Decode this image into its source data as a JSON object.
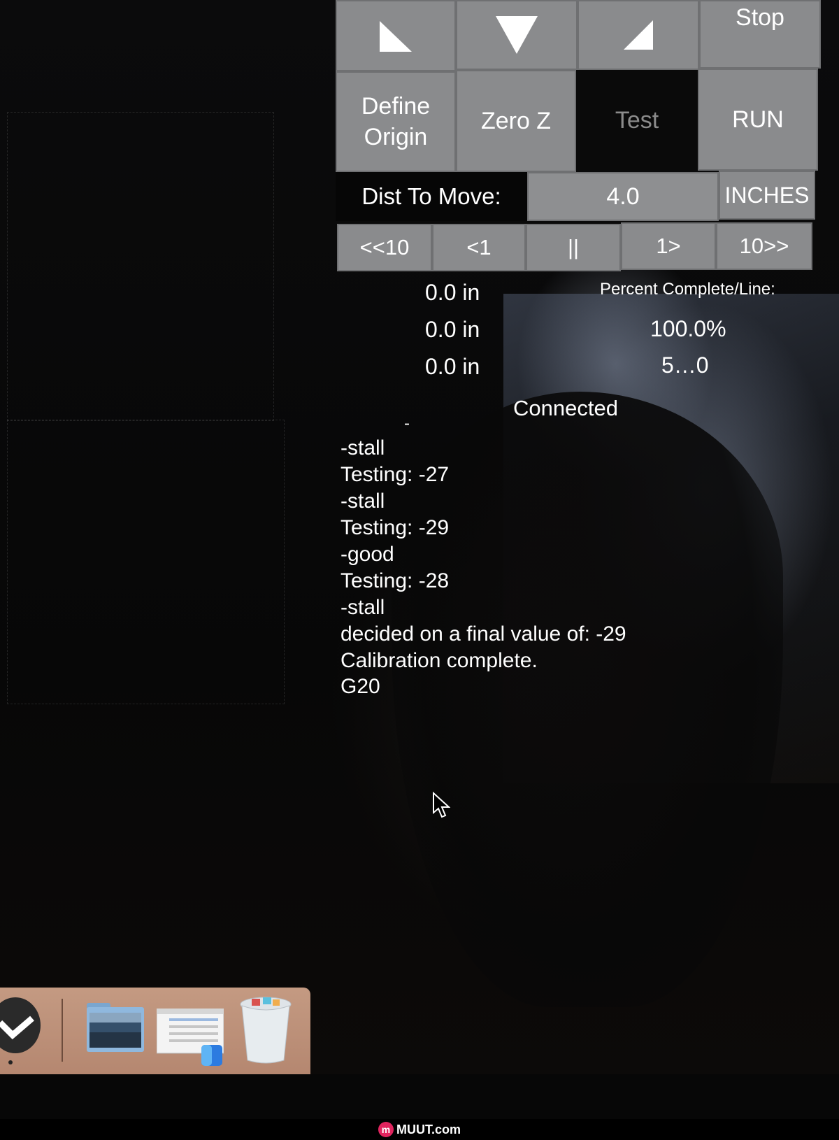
{
  "jog": {
    "buttons": [
      {
        "name": "jog-down-left-button",
        "icon": "arrow-down-left-icon"
      },
      {
        "name": "jog-down-button",
        "icon": "arrow-down-icon"
      },
      {
        "name": "jog-down-right-button",
        "icon": "arrow-down-right-icon"
      }
    ],
    "stop_label": "Stop"
  },
  "actions": {
    "define_origin_label": "Define\nOrigin",
    "zero_z_label": "Zero Z",
    "test_label": "Test",
    "run_label": "RUN"
  },
  "distance": {
    "label": "Dist To Move:",
    "value": "4.0",
    "units": "INCHES"
  },
  "run_controls": {
    "back_10_label": "<<10",
    "back_1_label": "<1",
    "pause_label": "||",
    "forward_1_label": "1>",
    "forward_10_label": "10>>"
  },
  "position": {
    "x": "0.0 in",
    "y": "0.0 in",
    "z": "0.0 in"
  },
  "progress": {
    "label": "Percent Complete/Line:",
    "percent": "100.0%",
    "line": "5…0"
  },
  "status": "Connected",
  "console": {
    "partial_top": "-",
    "lines": [
      "-stall",
      "Testing: -27",
      "-stall",
      "Testing: -29",
      "-good",
      "Testing: -28",
      "-stall",
      "decided on a final value of: -29",
      "Calibration complete.",
      "G20"
    ]
  },
  "dock": {
    "items": [
      {
        "name": "app-icon",
        "icon": "checkmark-icon"
      },
      {
        "name": "photo-folder-icon",
        "icon": "folder-icon"
      },
      {
        "name": "screenshot-thumbnail-icon",
        "icon": "window-icon"
      },
      {
        "name": "trash-icon",
        "icon": "trash-icon"
      }
    ]
  },
  "watermark": {
    "logo": "m",
    "text": "MUUT.com"
  },
  "colors": {
    "button_gray": "#8a8b8d",
    "panel_black": "#060606",
    "text_white": "#ffffff",
    "disabled_text": "#8b8b8b"
  }
}
